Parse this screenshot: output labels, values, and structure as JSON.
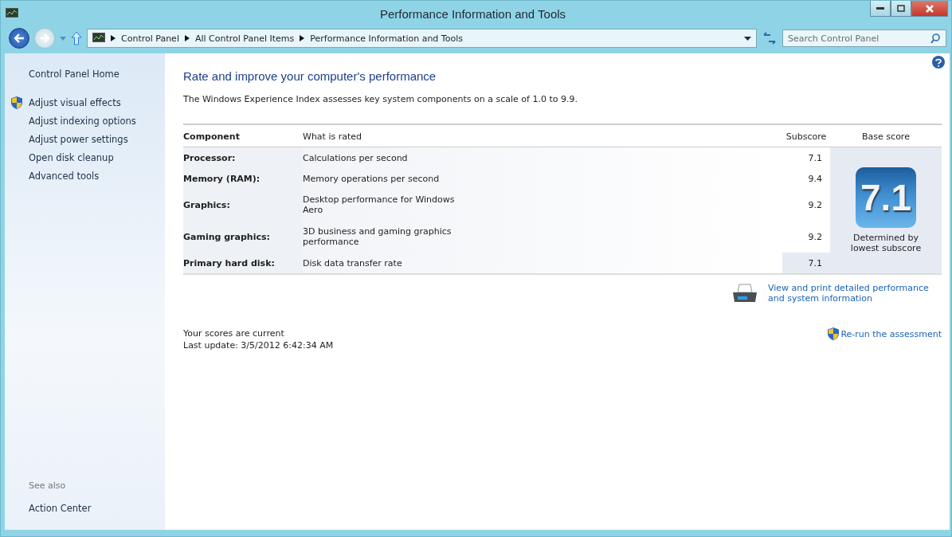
{
  "window": {
    "title": "Performance Information and Tools"
  },
  "breadcrumb": [
    "Control Panel",
    "All Control Panel Items",
    "Performance Information and Tools"
  ],
  "search": {
    "placeholder": "Search Control Panel"
  },
  "sidebar": {
    "home": "Control Panel Home",
    "items": [
      {
        "label": "Adjust visual effects",
        "shield": true
      },
      {
        "label": "Adjust indexing options",
        "shield": false
      },
      {
        "label": "Adjust power settings",
        "shield": false
      },
      {
        "label": "Open disk cleanup",
        "shield": false
      },
      {
        "label": "Advanced tools",
        "shield": false
      }
    ],
    "see_also": "See also",
    "see_also_items": [
      "Action Center"
    ]
  },
  "heading": "Rate and improve your computer's performance",
  "intro": "The Windows Experience Index assesses key system components on a scale of 1.0 to 9.9.",
  "table": {
    "columns": [
      "Component",
      "What is rated",
      "Subscore",
      "Base score"
    ],
    "rows": [
      {
        "component": "Processor:",
        "rated": "Calculations per second",
        "subscore": "7.1",
        "highlighted": false
      },
      {
        "component": "Memory (RAM):",
        "rated": "Memory operations per second",
        "subscore": "9.4",
        "highlighted": false
      },
      {
        "component": "Graphics:",
        "rated": "Desktop performance for Windows Aero",
        "subscore": "9.2",
        "highlighted": false
      },
      {
        "component": "Gaming graphics:",
        "rated": "3D business and gaming graphics performance",
        "subscore": "9.2",
        "highlighted": false
      },
      {
        "component": "Primary hard disk:",
        "rated": "Disk data transfer rate",
        "subscore": "7.1",
        "highlighted": true
      }
    ],
    "base_score": "7.1",
    "base_note": "Determined by lowest subscore"
  },
  "print_link": "View and print detailed performance and system information",
  "status": [
    "Your scores are current",
    "Last update: 3/5/2012 6:42:34 AM"
  ],
  "rerun_link": "Re-run the assessment"
}
